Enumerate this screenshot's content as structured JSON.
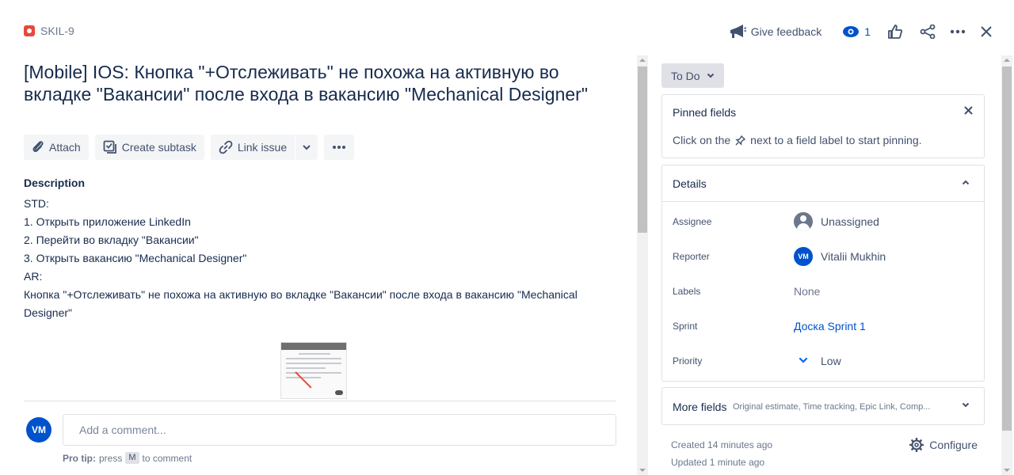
{
  "header": {
    "issue_key": "SKIL-9",
    "feedback_label": "Give feedback",
    "watch_count": "1"
  },
  "issue": {
    "title": "[Mobile] IOS: Кнопка \"+Отслеживать\" не похожа на активную во вкладке \"Вакансии\" после входа в вакансию \"Mechanical Designer\""
  },
  "toolbar": {
    "attach": "Attach",
    "create_subtask": "Create subtask",
    "link_issue": "Link issue"
  },
  "description": {
    "label": "Description",
    "lines": [
      "STD:",
      "1. Открыть приложение LinkedIn",
      "2. Перейти во вкладку \"Вакансии\"",
      "3. Открыть вакансию \"Mechanical Designer\"",
      "AR:",
      "Кнопка \"+Отслеживать\" не похожа на активную во вкладке \"Вакансии\" после входа в вакансию \"Mechanical Designer\""
    ]
  },
  "comment": {
    "avatar_initials": "VM",
    "placeholder": "Add a comment...",
    "pro_tip_bold": "Pro tip:",
    "pro_tip_press": "press",
    "pro_tip_key": "M",
    "pro_tip_rest": "to comment"
  },
  "status": {
    "label": "To Do"
  },
  "pinned": {
    "title": "Pinned fields",
    "hint_before": "Click on the",
    "hint_after": "next to a field label to start pinning."
  },
  "details": {
    "title": "Details",
    "assignee_label": "Assignee",
    "assignee_value": "Unassigned",
    "reporter_label": "Reporter",
    "reporter_initials": "VM",
    "reporter_value": "Vitalii Mukhin",
    "labels_label": "Labels",
    "labels_value": "None",
    "sprint_label": "Sprint",
    "sprint_value": "Доска Sprint 1",
    "priority_label": "Priority",
    "priority_value": "Low"
  },
  "more_fields": {
    "title": "More fields",
    "summary": "Original estimate, Time tracking, Epic Link, Comp..."
  },
  "meta": {
    "created": "Created 14 minutes ago",
    "updated": "Updated 1 minute ago",
    "configure": "Configure"
  },
  "colors": {
    "bug": "#e5493a",
    "link": "#0052cc",
    "avatar": "#0052cc"
  }
}
